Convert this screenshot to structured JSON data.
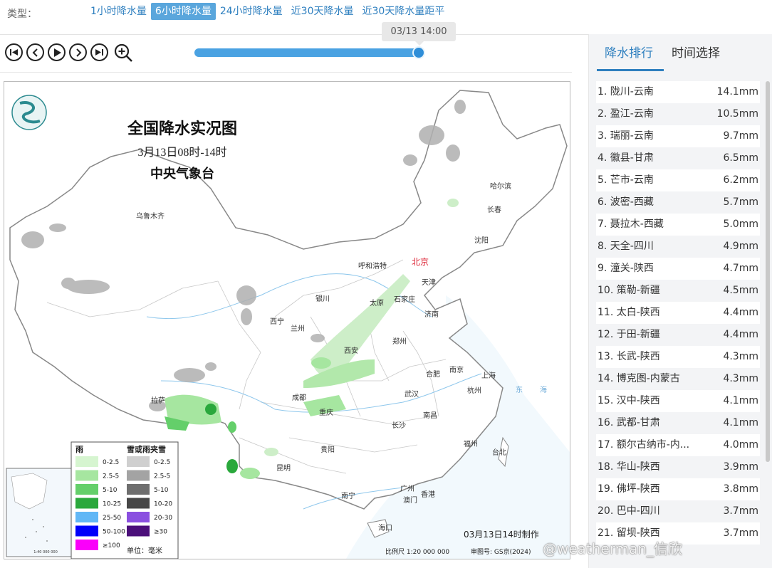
{
  "typebar": {
    "label": "类型：",
    "tabs": [
      "1小时降水量",
      "6小时降水量",
      "24小时降水量",
      "近30天降水量",
      "近30天降水量距平"
    ],
    "active_index": 1
  },
  "player": {
    "buttons": [
      "first-frame-icon",
      "previous-icon",
      "play-icon",
      "next-icon",
      "last-frame-icon",
      "zoom-in-icon"
    ],
    "time_tooltip": "03/13 14:00",
    "progress": 1.0
  },
  "map": {
    "title": "全国降水实况图",
    "subtitle": "3月13日08时-14时",
    "issuer": "中央气象台",
    "made_time": "03月13日14时制作",
    "scale": "比例尺 1:20 000 000",
    "review_no": "审图号: GS京(2024)",
    "inset_scale": "1:40 000 000",
    "legend": {
      "rain_title": "雨",
      "snow_title": "雪或雨夹雪",
      "unit": "单位：毫米",
      "rain": [
        {
          "label": "0-2.5",
          "color": "#d6f5d0"
        },
        {
          "label": "2.5-5",
          "color": "#a6e6a0"
        },
        {
          "label": "5-10",
          "color": "#64cf6a"
        },
        {
          "label": "10-25",
          "color": "#2aa83c"
        },
        {
          "label": "25-50",
          "color": "#61b7f6"
        },
        {
          "label": "50-100",
          "color": "#0000fa"
        },
        {
          "label": "≥100",
          "color": "#fa00fa"
        }
      ],
      "snow": [
        {
          "label": "0-2.5",
          "color": "#cfcfcf"
        },
        {
          "label": "2.5-5",
          "color": "#a3a3a3"
        },
        {
          "label": "5-10",
          "color": "#6e6e6e"
        },
        {
          "label": "10-20",
          "color": "#474747"
        },
        {
          "label": "20-30",
          "color": "#8a4fe0"
        },
        {
          "label": "≥30",
          "color": "#4b0f7a"
        }
      ]
    },
    "cities": {
      "urumqi": "乌鲁木齐",
      "harbin": "哈尔滨",
      "changchun": "长春",
      "shenyang": "沈阳",
      "hohhot": "呼和浩特",
      "beijing": "北京",
      "tianjin": "天津",
      "shijiazhuang": "石家庄",
      "taiyuan": "太原",
      "jinan": "济南",
      "yinchuan": "银川",
      "xining": "西宁",
      "lanzhou": "兰州",
      "xian": "西安",
      "zhengzhou": "郑州",
      "hefei": "合肥",
      "nanjing": "南京",
      "shanghai": "上海",
      "hangzhou": "杭州",
      "wuhan": "武汉",
      "chengdu": "成都",
      "chongqing": "重庆",
      "lhasa": "拉萨",
      "nanchang": "南昌",
      "changsha": "长沙",
      "fuzhou": "福州",
      "taipei": "台北",
      "guiyang": "贵阳",
      "kunming": "昆明",
      "guangzhou": "广州",
      "nanning": "南宁",
      "hongkong": "香港",
      "macau": "澳门",
      "haikou": "海口",
      "east_sea": "东",
      "east_sea2": "海"
    }
  },
  "panel": {
    "tabs": [
      "降水排行",
      "时间选择"
    ],
    "active_index": 0,
    "rankings": [
      {
        "name": "1. 陇川-云南",
        "value": "14.1mm"
      },
      {
        "name": "2. 盈江-云南",
        "value": "10.5mm"
      },
      {
        "name": "3. 瑞丽-云南",
        "value": "9.7mm"
      },
      {
        "name": "4. 徽县-甘肃",
        "value": "6.5mm"
      },
      {
        "name": "5. 芒市-云南",
        "value": "6.2mm"
      },
      {
        "name": "6. 波密-西藏",
        "value": "5.7mm"
      },
      {
        "name": "7. 聂拉木-西藏",
        "value": "5.0mm"
      },
      {
        "name": "8. 天全-四川",
        "value": "4.9mm"
      },
      {
        "name": "9. 潼关-陕西",
        "value": "4.7mm"
      },
      {
        "name": "10. 策勒-新疆",
        "value": "4.5mm"
      },
      {
        "name": "11. 太白-陕西",
        "value": "4.4mm"
      },
      {
        "name": "12. 于田-新疆",
        "value": "4.4mm"
      },
      {
        "name": "13. 长武-陕西",
        "value": "4.3mm"
      },
      {
        "name": "14. 博克图-内蒙古",
        "value": "4.3mm"
      },
      {
        "name": "15. 汉中-陕西",
        "value": "4.1mm"
      },
      {
        "name": "16. 武都-甘肃",
        "value": "4.1mm"
      },
      {
        "name": "17. 额尔古纳市-内...",
        "value": "4.0mm"
      },
      {
        "name": "18. 华山-陕西",
        "value": "3.9mm"
      },
      {
        "name": "19. 佛坪-陕西",
        "value": "3.8mm"
      },
      {
        "name": "20. 巴中-四川",
        "value": "3.7mm"
      },
      {
        "name": "21. 留坝-陕西",
        "value": "3.7mm"
      }
    ]
  },
  "watermark": "@weatherman_信欣"
}
